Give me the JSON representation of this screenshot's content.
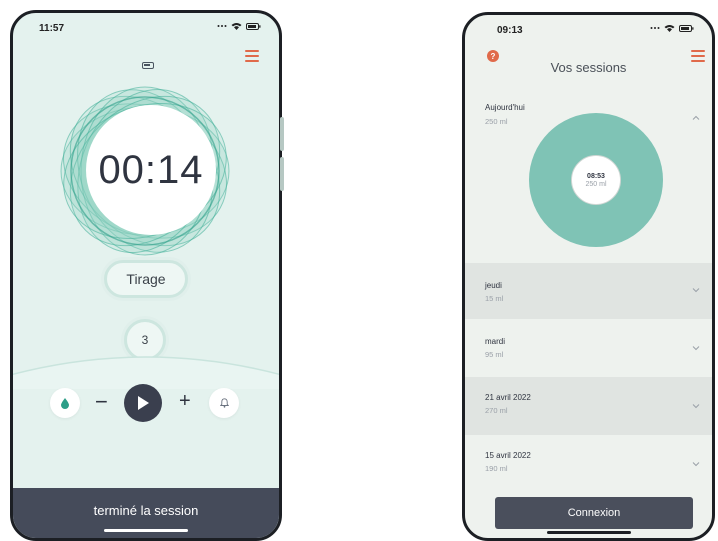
{
  "left_phone": {
    "status_time": "11:57",
    "timer": "00:14",
    "mode_button": "Tirage",
    "counter": "3",
    "minus_symbol": "−",
    "plus_symbol": "+",
    "end_session_label": "terminé la session",
    "accent_color": "#e06a4a",
    "theme_color": "#7fc3b5"
  },
  "right_phone": {
    "status_time": "09:13",
    "help_symbol": "?",
    "title": "Vos sessions",
    "today": {
      "label": "Aujourd'hui",
      "value": "250 ml",
      "entry_time": "08:53",
      "entry_value": "250 ml"
    },
    "sessions": [
      {
        "label": "jeudi",
        "value": "15 ml"
      },
      {
        "label": "mardi",
        "value": "95 ml"
      },
      {
        "label": "21 avril 2022",
        "value": "270 ml"
      },
      {
        "label": "15 avril 2022",
        "value": "190 ml"
      }
    ],
    "connect_label": "Connexion"
  }
}
